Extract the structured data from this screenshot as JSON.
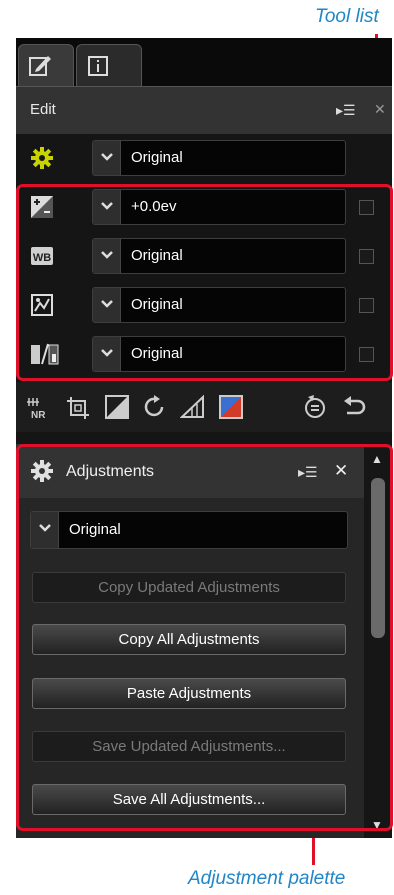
{
  "callouts": {
    "tool_list": "Tool list",
    "adjustment_palette": "Adjustment palette"
  },
  "tabs": [
    {
      "icon": "edit-icon"
    },
    {
      "icon": "info-icon"
    }
  ],
  "edit_panel": {
    "title": "Edit"
  },
  "tool_rows": [
    {
      "icon": "settings-gear-icon",
      "value": "Original"
    },
    {
      "icon": "exposure-compensation-icon",
      "value": "+0.0ev"
    },
    {
      "icon": "white-balance-icon",
      "value": "Original"
    },
    {
      "icon": "picture-control-icon",
      "value": "Original"
    },
    {
      "icon": "levels-curves-icon",
      "value": "Original"
    }
  ],
  "toolbar": {
    "icons": [
      "noise-reduction-icon",
      "crop-icon",
      "levels-icon",
      "rotate-icon",
      "straighten-icon",
      "color-balance-icon",
      "step-back-icon",
      "undo-icon"
    ]
  },
  "adjustments": {
    "title": "Adjustments",
    "dropdown_value": "Original",
    "buttons": [
      {
        "label": "Copy Updated Adjustments",
        "enabled": false
      },
      {
        "label": "Copy All Adjustments",
        "enabled": true
      },
      {
        "label": "Paste Adjustments",
        "enabled": true
      },
      {
        "label": "Save Updated Adjustments...",
        "enabled": false
      },
      {
        "label": "Save All Adjustments...",
        "enabled": true
      }
    ]
  },
  "colors": {
    "callout_text": "#1f86c8",
    "callout_line": "#e0102a",
    "gear": "#c8d400"
  }
}
